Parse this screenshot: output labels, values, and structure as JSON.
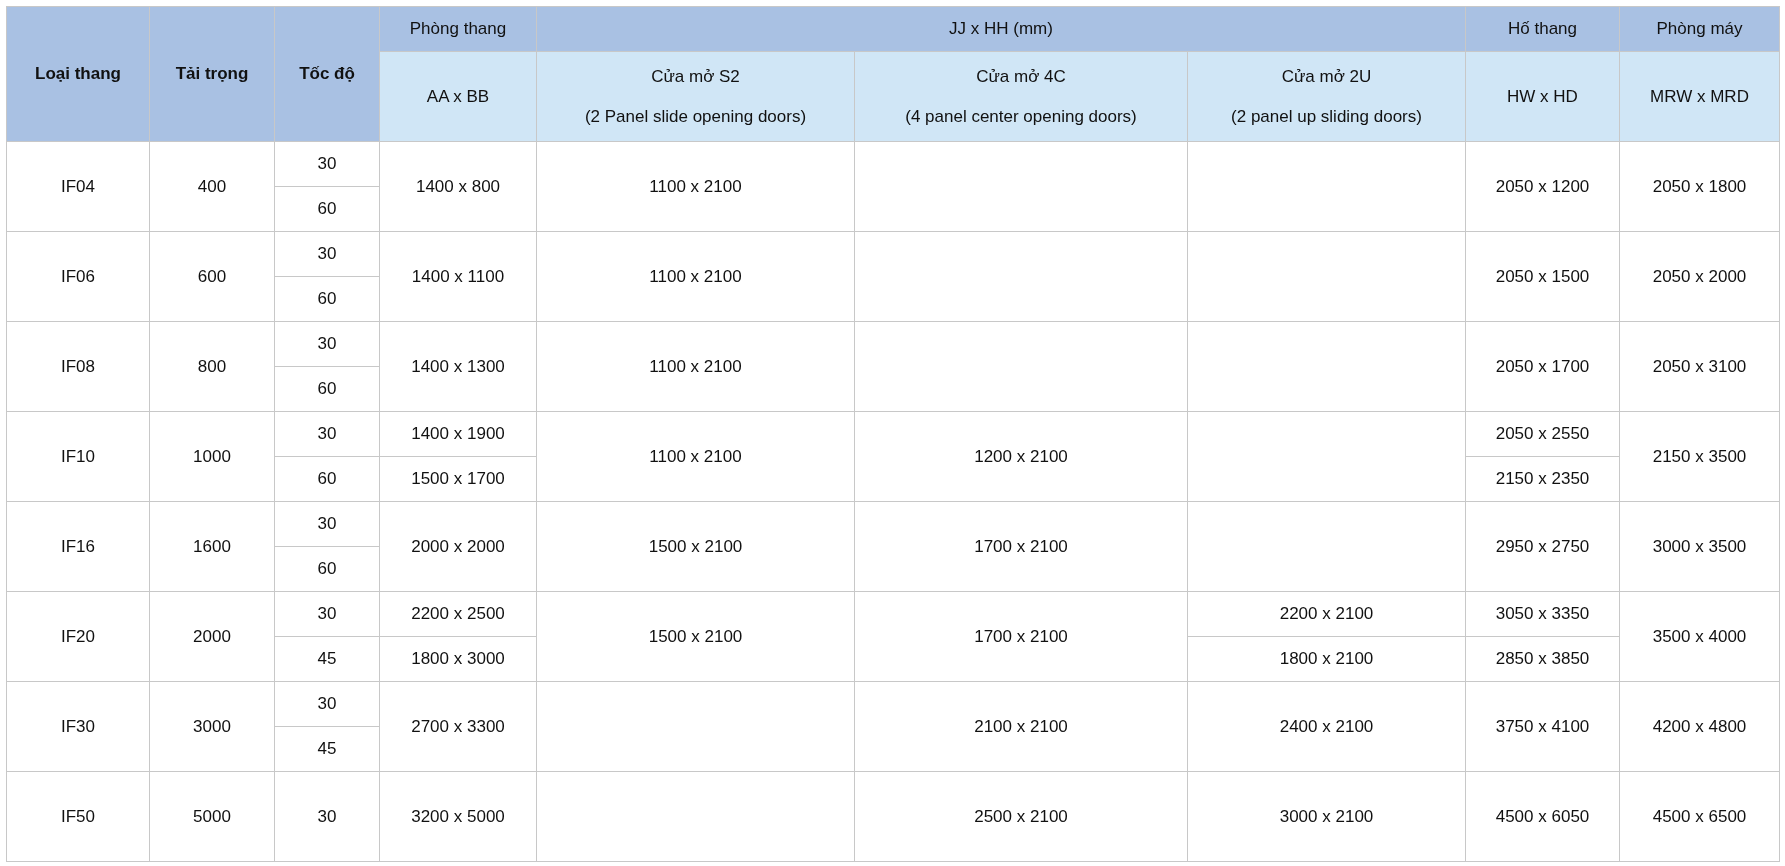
{
  "header": {
    "top": [
      {
        "lines": [
          "Loại thang"
        ],
        "bold": true,
        "rowspan": 2
      },
      {
        "lines": [
          "Tải trọng"
        ],
        "bold": true,
        "rowspan": 2
      },
      {
        "lines": [
          "Tốc độ"
        ],
        "bold": true,
        "rowspan": 2
      },
      {
        "lines": [
          "Phòng thang"
        ],
        "bold": false
      },
      {
        "lines": [
          "JJ x HH (mm)"
        ],
        "bold": false,
        "colspan": 3
      },
      {
        "lines": [
          "Hố thang"
        ],
        "bold": false
      },
      {
        "lines": [
          "Phòng máy"
        ],
        "bold": false
      }
    ],
    "sub": [
      {
        "lines": [
          "AA x BB"
        ],
        "bold": false
      },
      {
        "lines": [
          "Cửa mở S2",
          "(2 Panel slide opening doors)"
        ],
        "bold": false
      },
      {
        "lines": [
          "Cửa mở 4C",
          "(4 panel center opening doors)"
        ],
        "bold": false
      },
      {
        "lines": [
          "Cửa mở 2U",
          "(2 panel up sliding doors)"
        ],
        "bold": false
      },
      {
        "lines": [
          "HW x HD"
        ],
        "bold": false
      },
      {
        "lines": [
          "MRW x MRD"
        ],
        "bold": false
      }
    ]
  },
  "rows": [
    {
      "model": "IF04",
      "load": "400",
      "speeds": [
        "30",
        "60"
      ],
      "cabin": [
        "1400 x 800"
      ],
      "s2": [
        "1100 x 2100"
      ],
      "shaft": [
        "2050 x 1200"
      ],
      "machine": [
        "2050 x 1800"
      ]
    },
    {
      "model": "IF06",
      "load": "600",
      "speeds": [
        "30",
        "60"
      ],
      "cabin": [
        "1400 x 1100"
      ],
      "s2": [
        "1100 x 2100"
      ],
      "shaft": [
        "2050 x 1500"
      ],
      "machine": [
        "2050 x 2000"
      ]
    },
    {
      "model": "IF08",
      "load": "800",
      "speeds": [
        "30",
        "60"
      ],
      "cabin": [
        "1400 x 1300"
      ],
      "s2": [
        "1100 x 2100"
      ],
      "shaft": [
        "2050 x 1700"
      ],
      "machine": [
        "2050 x 3100"
      ]
    },
    {
      "model": "IF10",
      "load": "1000",
      "speeds": [
        "30",
        "60"
      ],
      "cabin": [
        "1400 x 1900",
        "1500 x 1700"
      ],
      "s2": [
        "1100 x 2100"
      ],
      "c4": [
        "1200 x 2100"
      ],
      "shaft": [
        "2050 x 2550",
        "2150 x 2350"
      ],
      "machine": [
        "2150 x 3500"
      ]
    },
    {
      "model": "IF16",
      "load": "1600",
      "speeds": [
        "30",
        "60"
      ],
      "cabin": [
        "2000 x 2000"
      ],
      "s2": [
        "1500 x 2100"
      ],
      "c4": [
        "1700 x 2100"
      ],
      "shaft": [
        "2950 x 2750"
      ],
      "machine": [
        "3000 x 3500"
      ]
    },
    {
      "model": "IF20",
      "load": "2000",
      "speeds": [
        "30",
        "45"
      ],
      "cabin": [
        "2200 x 2500",
        "1800 x 3000"
      ],
      "s2": [
        "1500 x 2100"
      ],
      "c4": [
        "1700 x 2100"
      ],
      "u2": [
        "2200 x 2100",
        "1800 x 2100"
      ],
      "shaft": [
        "3050 x 3350",
        "2850 x 3850"
      ],
      "machine": [
        "3500 x 4000"
      ]
    },
    {
      "model": "IF30",
      "load": "3000",
      "speeds": [
        "30",
        "45"
      ],
      "cabin": [
        "2700 x 3300"
      ],
      "c4": [
        "2100 x 2100"
      ],
      "u2": [
        "2400 x 2100"
      ],
      "shaft": [
        "3750 x 4100"
      ],
      "machine": [
        "4200 x 4800"
      ]
    },
    {
      "model": "IF50",
      "load": "5000",
      "speeds": [
        "30"
      ],
      "cabin": [
        "3200 x 5000"
      ],
      "c4": [
        "2500 x 2100"
      ],
      "u2": [
        "3000 x 2100"
      ],
      "shaft": [
        "4500 x 6050"
      ],
      "machine": [
        "4500 x 6500"
      ]
    }
  ]
}
